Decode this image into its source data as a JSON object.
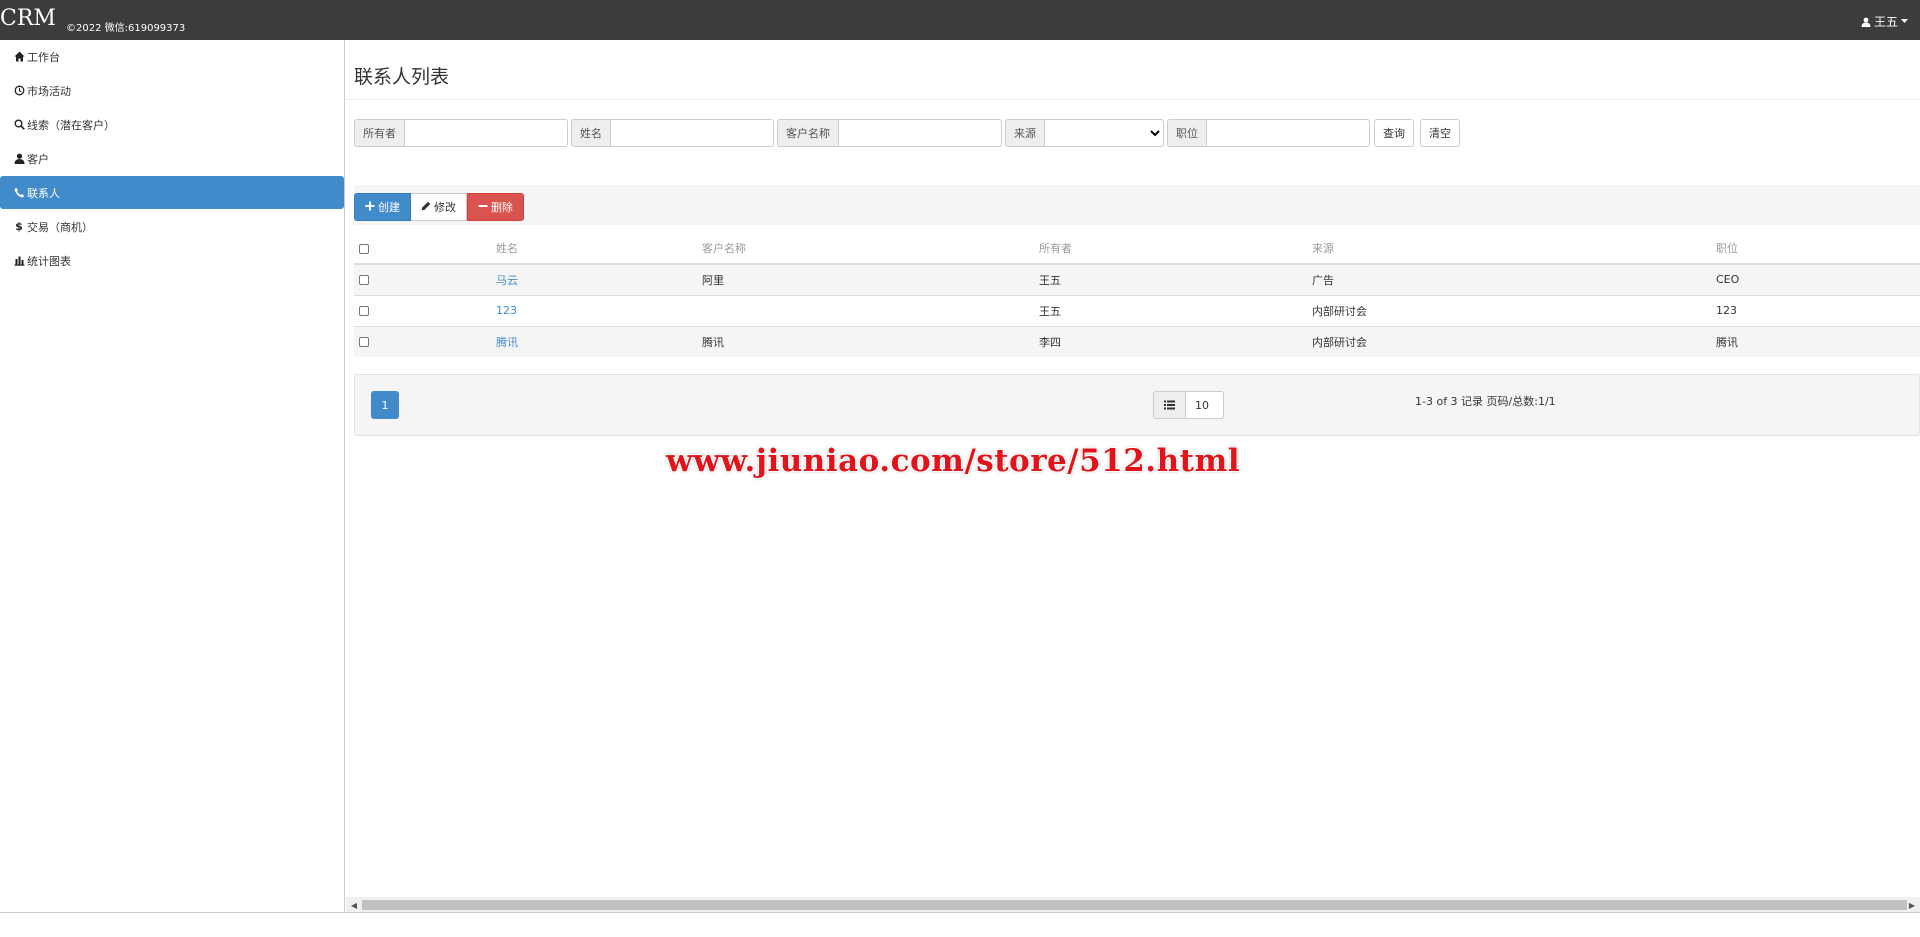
{
  "header": {
    "brand": "CRM",
    "copyright": "©2022 微信:619099373",
    "user_name": "王五"
  },
  "sidebar": {
    "items": [
      {
        "label": "工作台",
        "icon": "home-icon"
      },
      {
        "label": "市场活动",
        "icon": "time-icon"
      },
      {
        "label": "线索（潜在客户）",
        "icon": "search-icon"
      },
      {
        "label": "客户",
        "icon": "user-icon"
      },
      {
        "label": "联系人",
        "icon": "phone-icon",
        "active": true
      },
      {
        "label": "交易（商机）",
        "icon": "dollar-icon"
      },
      {
        "label": "统计图表",
        "icon": "chart-icon"
      }
    ]
  },
  "main": {
    "title": "联系人列表",
    "search": {
      "owner_label": "所有者",
      "name_label": "姓名",
      "customer_label": "客户名称",
      "source_label": "来源",
      "position_label": "职位",
      "query_button": "查询",
      "clear_button": "清空"
    },
    "toolbar": {
      "create": "创建",
      "edit": "修改",
      "delete": "删除"
    },
    "table": {
      "columns": [
        "姓名",
        "客户名称",
        "所有者",
        "来源",
        "职位"
      ],
      "rows": [
        {
          "name": "马云",
          "customer": "阿里",
          "owner": "王五",
          "source": "广告",
          "position": "CEO"
        },
        {
          "name": "123",
          "customer": "",
          "owner": "王五",
          "source": "内部研讨会",
          "position": "123"
        },
        {
          "name": "腾讯",
          "customer": "腾讯",
          "owner": "李四",
          "source": "内部研讨会",
          "position": "腾讯"
        }
      ]
    },
    "pagination": {
      "current_page": "1",
      "page_size": "10",
      "info": "1-3 of 3 记录 页码/总数:1/1"
    },
    "watermark": "www.jiuniao.com/store/512.html"
  },
  "colors": {
    "topbar": "#3c3c3c",
    "primary": "#428bca",
    "danger": "#d9534f",
    "watermark": "#e0141a"
  }
}
